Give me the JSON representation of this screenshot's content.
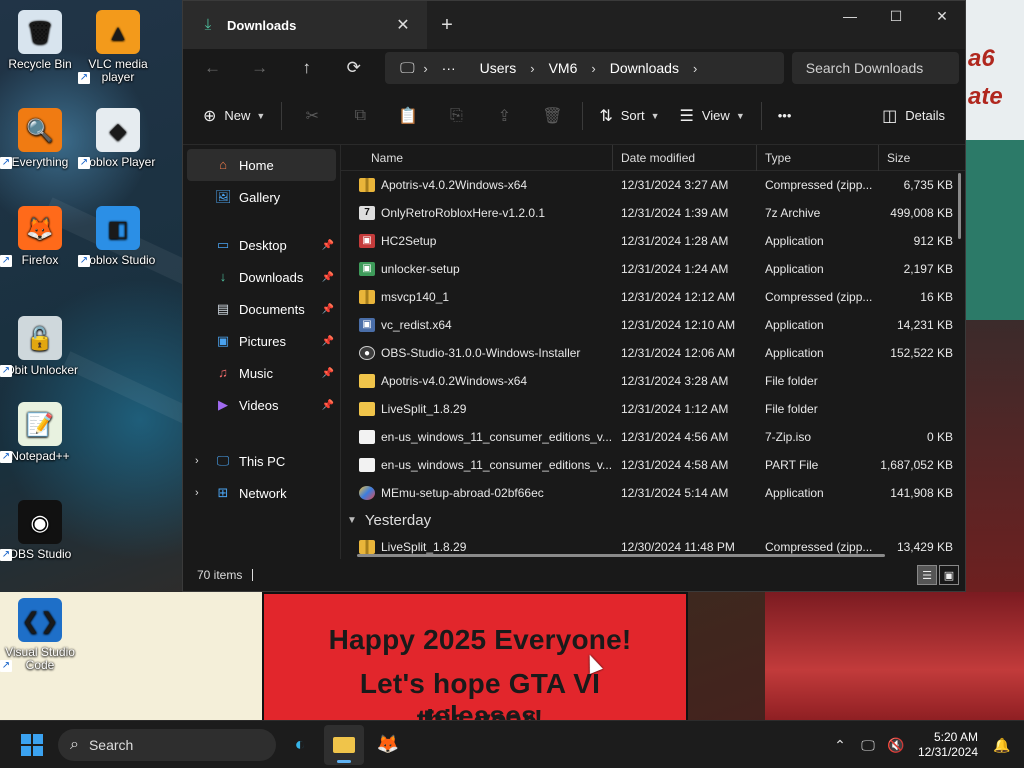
{
  "desktop": {
    "icons": [
      {
        "label": "Recycle Bin",
        "glyph": "🗑"
      },
      {
        "label": "VLC media player",
        "glyph": "▲"
      },
      {
        "label": "Everything",
        "glyph": "🔍"
      },
      {
        "label": "Roblox Player",
        "glyph": "◆"
      },
      {
        "label": "Firefox",
        "glyph": "🦊"
      },
      {
        "label": "Roblox Studio",
        "glyph": "◧"
      },
      {
        "label": "IObit Unlocker",
        "glyph": "🔓"
      },
      {
        "label": "Notepad++",
        "glyph": "📝"
      },
      {
        "label": "OBS Studio",
        "glyph": "◉"
      },
      {
        "label": "Visual Studio Code",
        "glyph": "❮❯"
      }
    ],
    "wallpaper_text": {
      "line1": "Happy 2025 Everyone!",
      "line2": "Let's hope GTA VI releases",
      "line3": "this year!",
      "side": "a6 ate"
    }
  },
  "window": {
    "tab_title": "Downloads",
    "tab_close": "✕",
    "new_tab": "+",
    "controls": {
      "minimize": "—",
      "maximize": "☐",
      "close": "✕"
    },
    "nav": {
      "back": "←",
      "forward": "→",
      "up": "↑",
      "refresh": "⟳"
    },
    "address": {
      "pc_icon": "🖵",
      "more": "···",
      "crumbs": [
        "Users",
        "VM6",
        "Downloads"
      ],
      "sep": "›"
    },
    "search_placeholder": "Search Downloads",
    "commands": {
      "new": "New",
      "sort": "Sort",
      "view": "View",
      "more": "•••",
      "details": "Details"
    },
    "sidebar": {
      "top": [
        {
          "label": "Home",
          "icon": "⌂"
        },
        {
          "label": "Gallery",
          "icon": "🖼"
        }
      ],
      "pinned": [
        {
          "label": "Desktop",
          "icon": "▭"
        },
        {
          "label": "Downloads",
          "icon": "↓"
        },
        {
          "label": "Documents",
          "icon": "▤"
        },
        {
          "label": "Pictures",
          "icon": "▣"
        },
        {
          "label": "Music",
          "icon": "♫"
        },
        {
          "label": "Videos",
          "icon": "▶"
        }
      ],
      "roots": [
        {
          "label": "This PC",
          "icon": "🖵"
        },
        {
          "label": "Network",
          "icon": "⊞"
        }
      ],
      "pin_glyph": "📌",
      "expand_glyph": "›"
    },
    "columns": {
      "name": "Name",
      "date": "Date modified",
      "type": "Type",
      "size": "Size"
    },
    "files": [
      {
        "name": "Apotris-v4.0.2Windows-x64",
        "date": "12/31/2024 3:27 AM",
        "type": "Compressed (zipp...",
        "size": "6,735 KB",
        "icon": "zip"
      },
      {
        "name": "OnlyRetroRobloxHere-v1.2.0.1",
        "date": "12/31/2024 1:39 AM",
        "type": "7z Archive",
        "size": "499,008 KB",
        "icon": "7z"
      },
      {
        "name": "HC2Setup",
        "date": "12/31/2024 1:28 AM",
        "type": "Application",
        "size": "912 KB",
        "icon": "app3"
      },
      {
        "name": "unlocker-setup",
        "date": "12/31/2024 1:24 AM",
        "type": "Application",
        "size": "2,197 KB",
        "icon": "app2"
      },
      {
        "name": "msvcp140_1",
        "date": "12/31/2024 12:12 AM",
        "type": "Compressed (zipp...",
        "size": "16 KB",
        "icon": "zip"
      },
      {
        "name": "vc_redist.x64",
        "date": "12/31/2024 12:10 AM",
        "type": "Application",
        "size": "14,231 KB",
        "icon": "app"
      },
      {
        "name": "OBS-Studio-31.0.0-Windows-Installer",
        "date": "12/31/2024 12:06 AM",
        "type": "Application",
        "size": "152,522 KB",
        "icon": "obs"
      },
      {
        "name": "Apotris-v4.0.2Windows-x64",
        "date": "12/31/2024 3:28 AM",
        "type": "File folder",
        "size": "",
        "icon": "folder"
      },
      {
        "name": "LiveSplit_1.8.29",
        "date": "12/31/2024 1:12 AM",
        "type": "File folder",
        "size": "",
        "icon": "folder"
      },
      {
        "name": "en-us_windows_11_consumer_editions_v...",
        "date": "12/31/2024 4:56 AM",
        "type": "7-Zip.iso",
        "size": "0 KB",
        "icon": "file"
      },
      {
        "name": "en-us_windows_11_consumer_editions_v...",
        "date": "12/31/2024 4:58 AM",
        "type": "PART File",
        "size": "1,687,052 KB",
        "icon": "file"
      },
      {
        "name": "MEmu-setup-abroad-02bf66ec",
        "date": "12/31/2024 5:14 AM",
        "type": "Application",
        "size": "141,908 KB",
        "icon": "memu"
      }
    ],
    "group_yesterday": "Yesterday",
    "files_yesterday": [
      {
        "name": "LiveSplit_1.8.29",
        "date": "12/30/2024 11:48 PM",
        "type": "Compressed (zipp...",
        "size": "13,429 KB",
        "icon": "zip"
      }
    ],
    "status": {
      "count": "70 items"
    }
  },
  "taskbar": {
    "search_label": "Search",
    "time": "5:20 AM",
    "date": "12/31/2024",
    "apps": [
      {
        "name": "edge",
        "glyph": "◐"
      },
      {
        "name": "file-explorer",
        "glyph": "▬"
      },
      {
        "name": "firefox",
        "glyph": "🦊"
      }
    ]
  },
  "colors": {
    "accent": "#5fb2f2",
    "window_bg": "#191919",
    "taskbar_bg": "#1c1c1c"
  }
}
